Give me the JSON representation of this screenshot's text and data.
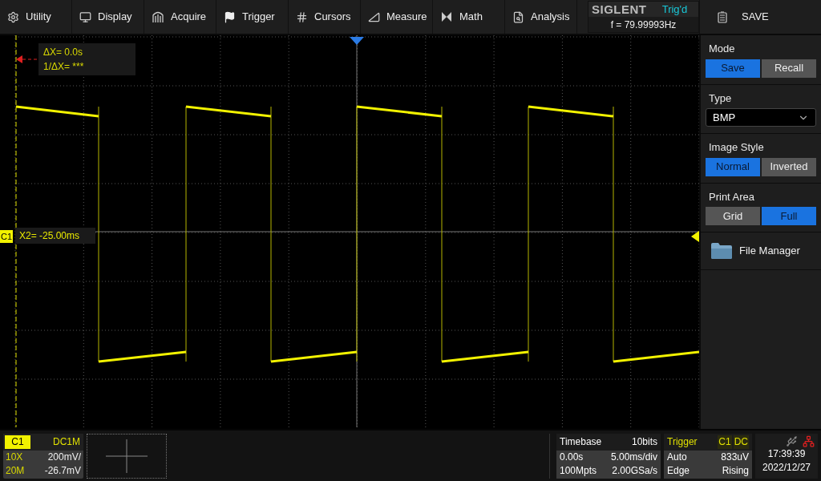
{
  "menu": [
    {
      "label": "Utility"
    },
    {
      "label": "Display"
    },
    {
      "label": "Acquire"
    },
    {
      "label": "Trigger"
    },
    {
      "label": "Cursors"
    },
    {
      "label": "Measure"
    },
    {
      "label": "Math"
    },
    {
      "label": "Analysis"
    }
  ],
  "brand": {
    "logo": "SIGLENT",
    "status": "Trig'd",
    "frequency": "f = 79.99993Hz"
  },
  "panel": {
    "title": "SAVE",
    "sections": [
      {
        "kind": "toggle",
        "label": "Mode",
        "options": [
          {
            "label": "Save",
            "selected": true
          },
          {
            "label": "Recall",
            "selected": false
          }
        ]
      },
      {
        "kind": "select",
        "label": "Type",
        "value": "BMP"
      },
      {
        "kind": "toggle",
        "label": "Image Style",
        "options": [
          {
            "label": "Normal",
            "selected": true
          },
          {
            "label": "Inverted",
            "selected": false
          }
        ]
      },
      {
        "kind": "toggle",
        "label": "Print Area",
        "options": [
          {
            "label": "Grid",
            "selected": false
          },
          {
            "label": "Full",
            "selected": true
          }
        ]
      },
      {
        "kind": "link",
        "label": "File Manager"
      }
    ]
  },
  "cursors": {
    "delta": "ΔX= 0.0s",
    "inverse": "1/ΔX= ***",
    "x2": "X2= -25.00ms",
    "channel_marker": "C1"
  },
  "channel": {
    "name": "C1",
    "coupling": "DC1M",
    "probe": "10X",
    "scale": "200mV/",
    "bandwidth": "20M",
    "offset": "-26.7mV"
  },
  "timebase": {
    "title": "Timebase",
    "bits": "10bits",
    "delay": "0.00s",
    "scale": "5.00ms/div",
    "depth": "100Mpts",
    "rate": "2.00GSa/s"
  },
  "trigger": {
    "title": "Trigger",
    "source": "C1",
    "coupling": "DC",
    "mode": "Auto",
    "level": "833uV",
    "type": "Edge",
    "slope": "Rising"
  },
  "clock": {
    "time": "17:39:39",
    "date": "2022/12/27"
  }
}
